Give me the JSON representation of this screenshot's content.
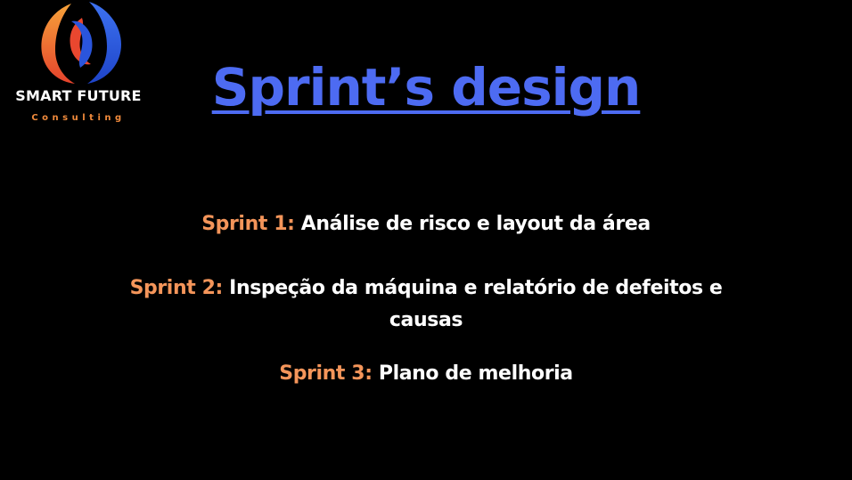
{
  "logo": {
    "name": "SMART FUTURE",
    "subtitle": "Consulting",
    "colors": {
      "orange": "#f08a3c",
      "blue": "#2b59e0",
      "red": "#e8402e"
    }
  },
  "title": "Sprint’s design",
  "sprints": [
    {
      "label": "Sprint 1:",
      "text": "Análise de risco e layout da área"
    },
    {
      "label": "Sprint 2:",
      "text": "Inspeção da máquina e relatório de defeitos e causas"
    },
    {
      "label": "Sprint 3:",
      "text": "Plano de melhoria"
    }
  ],
  "colors": {
    "background": "#000000",
    "title": "#4d6bf2",
    "sprint_label": "#f4955a",
    "body_text": "#ffffff"
  }
}
